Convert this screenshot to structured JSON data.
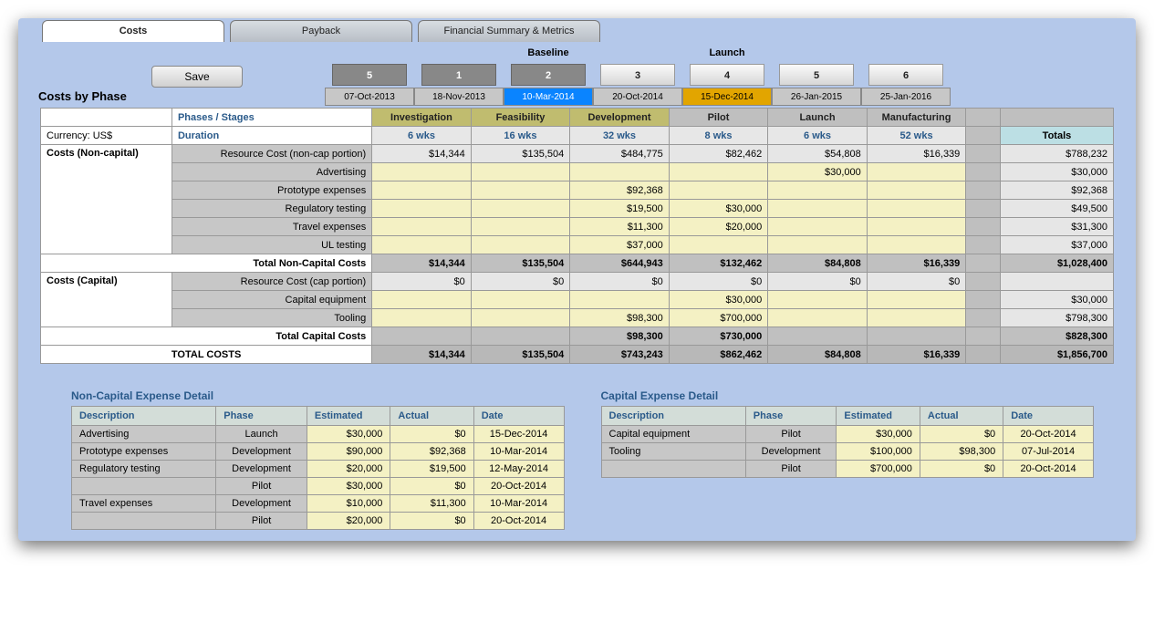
{
  "tabs": {
    "costs": "Costs",
    "payback": "Payback",
    "fin": "Financial Summary & Metrics"
  },
  "save_label": "Save",
  "section": "Costs by Phase",
  "gate_labels": {
    "baseline": "Baseline",
    "launch": "Launch"
  },
  "gates": [
    {
      "num": "5",
      "date": "07-Oct-2013",
      "num_cls": "done",
      "date_cls": ""
    },
    {
      "num": "1",
      "date": "18-Nov-2013",
      "num_cls": "done",
      "date_cls": ""
    },
    {
      "num": "2",
      "date": "10-Mar-2014",
      "num_cls": "done",
      "date_cls": "blue",
      "top": "Baseline"
    },
    {
      "num": "3",
      "date": "20-Oct-2014",
      "num_cls": "",
      "date_cls": ""
    },
    {
      "num": "4",
      "date": "15-Dec-2014",
      "num_cls": "",
      "date_cls": "amber",
      "top": "Launch"
    },
    {
      "num": "5",
      "date": "26-Jan-2015",
      "num_cls": "",
      "date_cls": ""
    },
    {
      "num": "6",
      "date": "25-Jan-2016",
      "num_cls": "",
      "date_cls": ""
    }
  ],
  "headers": {
    "phases_stages": "Phases / Stages",
    "currency": "Currency: US$",
    "duration": "Duration",
    "phases": [
      "Investigation",
      "Feasibility",
      "Development",
      "Pilot",
      "Launch",
      "Manufacturing"
    ],
    "durations": [
      "6 wks",
      "16 wks",
      "32 wks",
      "8 wks",
      "6 wks",
      "52 wks"
    ],
    "totals": "Totals"
  },
  "noncap_title": "Costs (Non-capital)",
  "noncap_rows": [
    {
      "label": "Resource Cost (non-cap portion)",
      "vals": [
        "$14,344",
        "$135,504",
        "$484,775",
        "$82,462",
        "$54,808",
        "$16,339"
      ],
      "total": "$788,232",
      "style": "num"
    },
    {
      "label": "Advertising",
      "vals": [
        "",
        "",
        "",
        "",
        "$30,000",
        ""
      ],
      "total": "$30,000",
      "style": "in"
    },
    {
      "label": "Prototype expenses",
      "vals": [
        "",
        "",
        "$92,368",
        "",
        "",
        ""
      ],
      "total": "$92,368",
      "style": "in"
    },
    {
      "label": "Regulatory testing",
      "vals": [
        "",
        "",
        "$19,500",
        "$30,000",
        "",
        ""
      ],
      "total": "$49,500",
      "style": "in"
    },
    {
      "label": "Travel expenses",
      "vals": [
        "",
        "",
        "$11,300",
        "$20,000",
        "",
        ""
      ],
      "total": "$31,300",
      "style": "in"
    },
    {
      "label": "UL testing",
      "vals": [
        "",
        "",
        "$37,000",
        "",
        "",
        ""
      ],
      "total": "$37,000",
      "style": "in"
    }
  ],
  "noncap_total": {
    "label": "Total Non-Capital Costs",
    "vals": [
      "$14,344",
      "$135,504",
      "$644,943",
      "$132,462",
      "$84,808",
      "$16,339"
    ],
    "total": "$1,028,400"
  },
  "cap_title": "Costs (Capital)",
  "cap_rows": [
    {
      "label": "Resource Cost (cap portion)",
      "vals": [
        "$0",
        "$0",
        "$0",
        "$0",
        "$0",
        "$0"
      ],
      "total": "",
      "style": "num"
    },
    {
      "label": "Capital equipment",
      "vals": [
        "",
        "",
        "",
        "$30,000",
        "",
        ""
      ],
      "total": "$30,000",
      "style": "in"
    },
    {
      "label": "Tooling",
      "vals": [
        "",
        "",
        "$98,300",
        "$700,000",
        "",
        ""
      ],
      "total": "$798,300",
      "style": "in"
    }
  ],
  "cap_total": {
    "label": "Total Capital Costs",
    "vals": [
      "",
      "",
      "$98,300",
      "$730,000",
      "",
      ""
    ],
    "total": "$828,300"
  },
  "grand": {
    "label": "TOTAL COSTS",
    "vals": [
      "$14,344",
      "$135,504",
      "$743,243",
      "$862,462",
      "$84,808",
      "$16,339"
    ],
    "total": "$1,856,700"
  },
  "nc_detail": {
    "title": "Non-Capital Expense Detail",
    "cols": [
      "Description",
      "Phase",
      "Estimated",
      "Actual",
      "Date"
    ],
    "rows": [
      [
        "Advertising",
        "Launch",
        "$30,000",
        "$0",
        "15-Dec-2014"
      ],
      [
        "Prototype expenses",
        "Development",
        "$90,000",
        "$92,368",
        "10-Mar-2014"
      ],
      [
        "Regulatory testing",
        "Development",
        "$20,000",
        "$19,500",
        "12-May-2014"
      ],
      [
        "",
        "Pilot",
        "$30,000",
        "$0",
        "20-Oct-2014"
      ],
      [
        "Travel expenses",
        "Development",
        "$10,000",
        "$11,300",
        "10-Mar-2014"
      ],
      [
        "",
        "Pilot",
        "$20,000",
        "$0",
        "20-Oct-2014"
      ]
    ]
  },
  "cap_detail": {
    "title": "Capital Expense Detail",
    "cols": [
      "Description",
      "Phase",
      "Estimated",
      "Actual",
      "Date"
    ],
    "rows": [
      [
        "Capital equipment",
        "Pilot",
        "$30,000",
        "$0",
        "20-Oct-2014"
      ],
      [
        "Tooling",
        "Development",
        "$100,000",
        "$98,300",
        "07-Jul-2014"
      ],
      [
        "",
        "Pilot",
        "$700,000",
        "$0",
        "20-Oct-2014"
      ]
    ]
  }
}
